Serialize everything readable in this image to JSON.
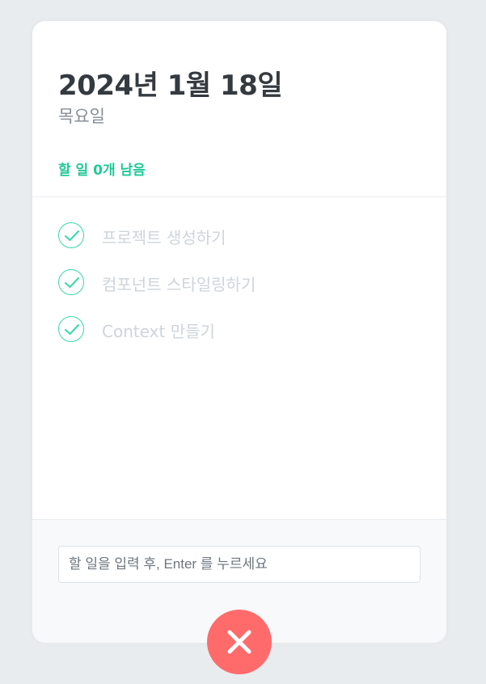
{
  "header": {
    "date": "2024년 1월 18일",
    "day": "목요일",
    "tasks_left": "할 일 0개 남음"
  },
  "todos": [
    {
      "text": "프로젝트 생성하기",
      "done": true
    },
    {
      "text": "컴포넌트 스타일링하기",
      "done": true
    },
    {
      "text": "Context 만들기",
      "done": true
    }
  ],
  "input": {
    "placeholder": "할 일을 입력 후, Enter 를 누르세요",
    "value": ""
  },
  "icons": {
    "check": "check-icon",
    "close": "close-icon"
  },
  "colors": {
    "accent": "#20c997",
    "check_border": "#38d9a9",
    "done_text": "#ced4da",
    "close_button": "#ff6b6b"
  }
}
